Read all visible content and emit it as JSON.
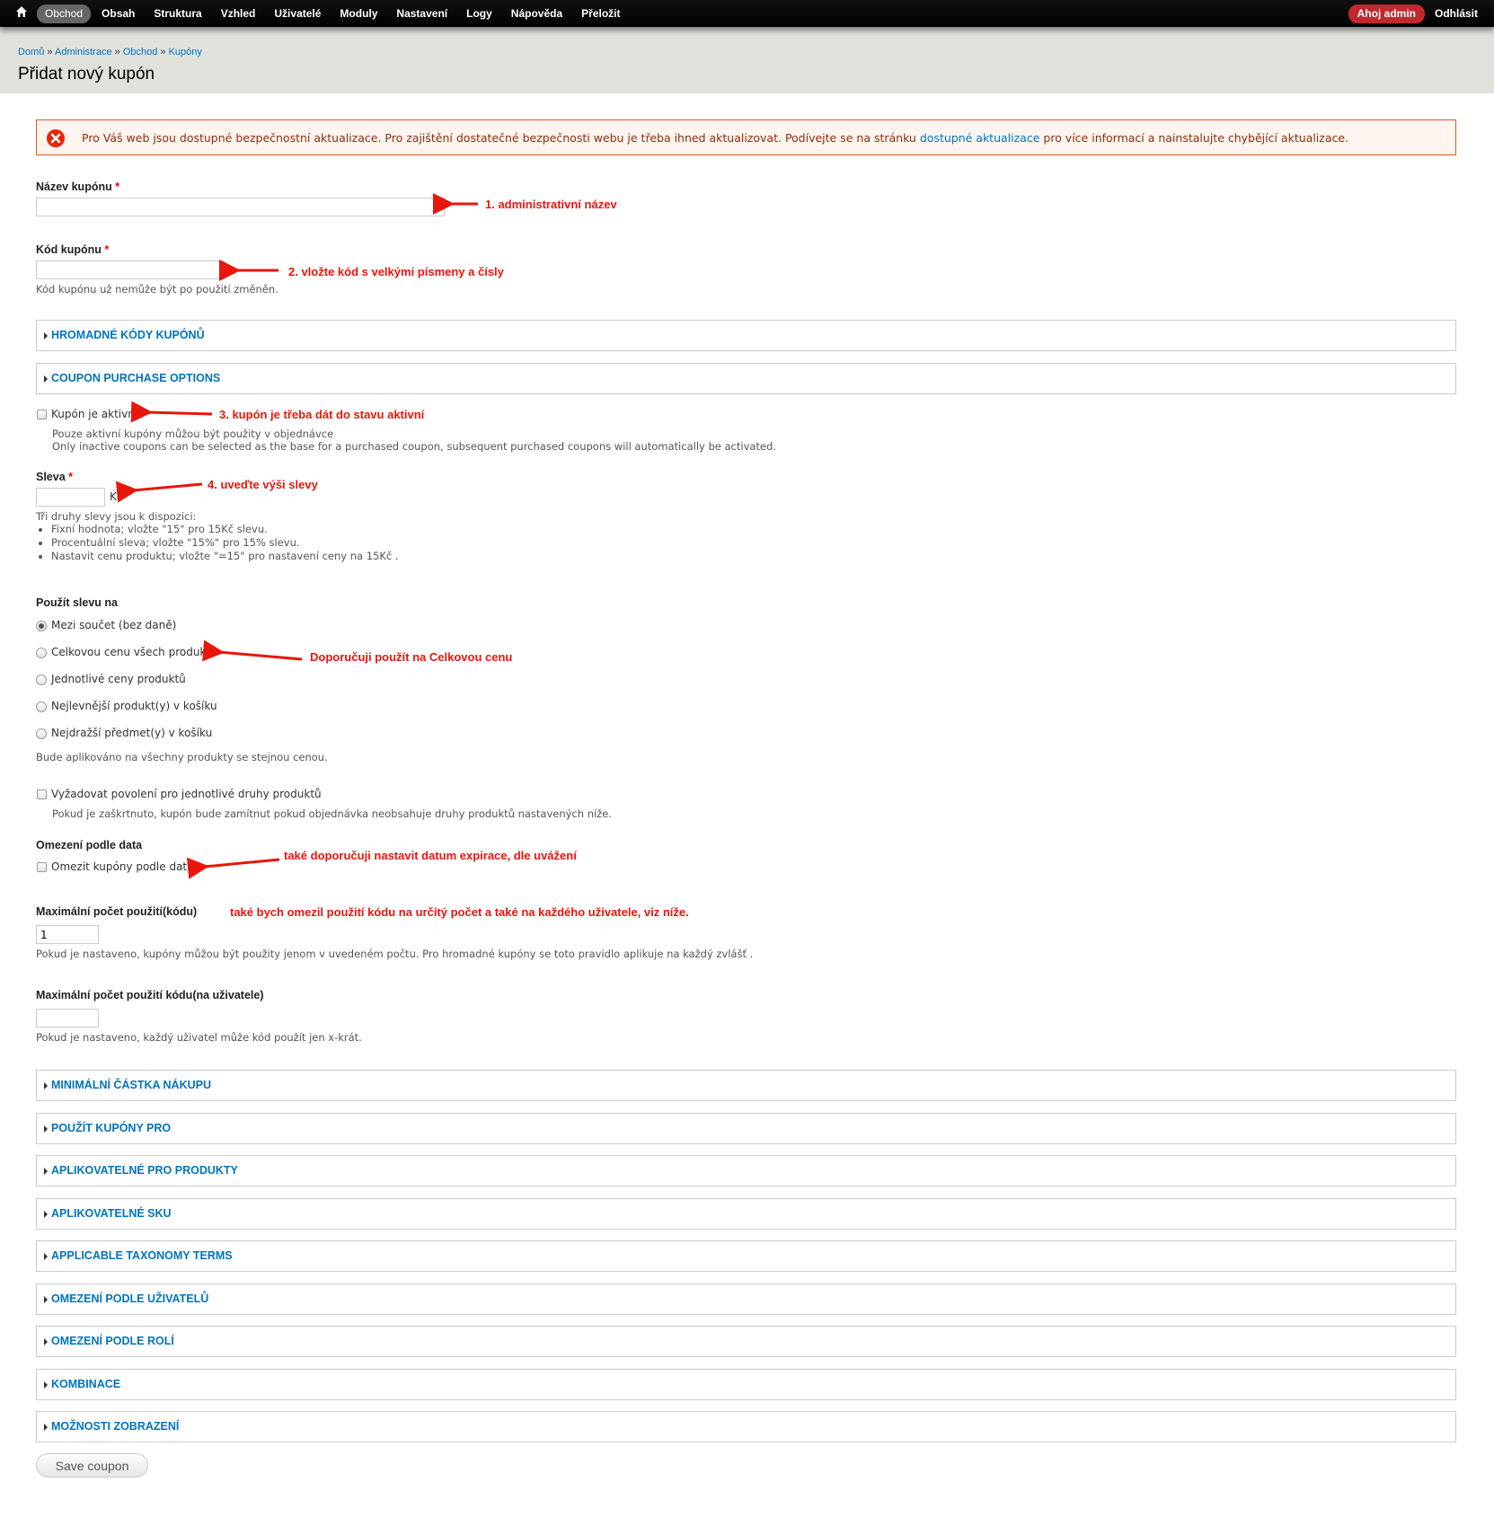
{
  "toolbar": {
    "menu": [
      "Obchod",
      "Obsah",
      "Struktura",
      "Vzhled",
      "Uživatelé",
      "Moduly",
      "Nastavení",
      "Logy",
      "Nápověda",
      "Přeložit"
    ],
    "greeting": "Ahoj",
    "user": "admin",
    "logout": "Odhlásit"
  },
  "breadcrumb": [
    "Domů",
    "Administrace",
    "Obchod",
    "Kupóny"
  ],
  "breadcrumb_sep": "»",
  "page_title": "Přidat nový kupón",
  "alert": {
    "text_before": "Pro Váš web jsou dostupné bezpečnostní aktualizace. Pro zajištění dostatečné bezpečnosti webu je třeba ihned aktualizovat. Podívejte se na stránku",
    "link": "dostupné aktualizace",
    "text_after": "pro více informací a nainstalujte chybějící aktualizace."
  },
  "form": {
    "name_label": "Název kupónu",
    "code_label": "Kód kupónu",
    "code_desc": "Kód kupónu už nemůže být po použití změněn.",
    "fieldset_bulk": "HROMADNÉ KÓDY KUPÓNŮ",
    "fieldset_purchase": "COUPON PURCHASE OPTIONS",
    "active_label": "Kupón je aktivní",
    "active_desc1": "Pouze aktivní kupóny můžou být použity v objednávce",
    "active_desc2": "Only inactive coupons can be selected as the base for a purchased coupon, subsequent purchased coupons will automatically be activated.",
    "discount_label": "Sleva",
    "discount_unit": "Kč",
    "discount_desc": "Tři druhy slevy jsou k dispozici:",
    "discount_types": [
      "Fixní hodnota; vložte \"15\" pro 15Kč slevu.",
      "Procentuální sleva; vložte \"15%\" pro 15% slevu.",
      "Nastavit cenu produktu; vložte \"=15\" pro nastavení ceny na 15Kč ."
    ],
    "apply_label": "Použít slevu na",
    "apply_options": [
      "Mezi součet (bez daně)",
      "Celkovou cenu všech produktů",
      "Jednotlivé ceny produktů",
      "Nejlevnější produkt(y) v košíku",
      "Nejdražší předmet(y) v košíku"
    ],
    "apply_selected": 0,
    "apply_desc": "Bude aplikováno na všechny produkty se stejnou cenou.",
    "require_label": "Vyžadovat povolení pro jednotlivé druhy produktů",
    "require_desc": "Pokud je zaškrtnuto, kupón bude zamítnut pokud objednávka neobsahuje druhy produktů nastavených níže.",
    "date_heading": "Omezení podle data",
    "date_label": "Omezit kupóny podle data.",
    "max_uses_label": "Maximální počet použití(kódu)",
    "max_uses_value": "1",
    "max_uses_desc": "Pokud je nastaveno, kupóny můžou být použity jenom v uvedeném počtu. Pro hromadné kupóny se toto pravidlo aplikuje na každý zvlášť .",
    "max_user_label": "Maximální počet použití kódu(na uživatele)",
    "max_user_desc": "Pokud je nastaveno, každý uživatel může kód použít jen x-krát.",
    "fieldsets": [
      "MINIMÁLNÍ ČÁSTKA NÁKUPU",
      "POUŽÍT KUPÓNY PRO",
      "APLIKOVATELNÉ PRO PRODUKTY",
      "APLIKOVATELNÉ SKU",
      "APPLICABLE TAXONOMY TERMS",
      "OMEZENÍ PODLE UŽIVATELŮ",
      "OMEZENÍ PODLE ROLÍ",
      "KOMBINACE",
      "MOŽNOSTI ZOBRAZENÍ"
    ],
    "save_label": "Save coupon"
  },
  "annotations": {
    "a1": "1. administrativní název",
    "a2": "2. vložte kód s velkými písmeny a čísly",
    "a3": "3. kupón je třeba dát do stavu aktivní",
    "a4": "4. uveďte výši slevy",
    "a5": "Doporučuji použít na Celkovou cenu",
    "a6": "také doporučuji nastavit datum expirace, dle uvážení",
    "a7": "také bych omezil použití kódu na určitý počet a také na každého uživatele, viz níže."
  },
  "colors": {
    "toolbar": "#000000",
    "header": "#e1e1dc",
    "link": "#0074bd",
    "annotation": "#e8160c",
    "alert_border": "#ed541d",
    "greeting": "#c0282d"
  }
}
